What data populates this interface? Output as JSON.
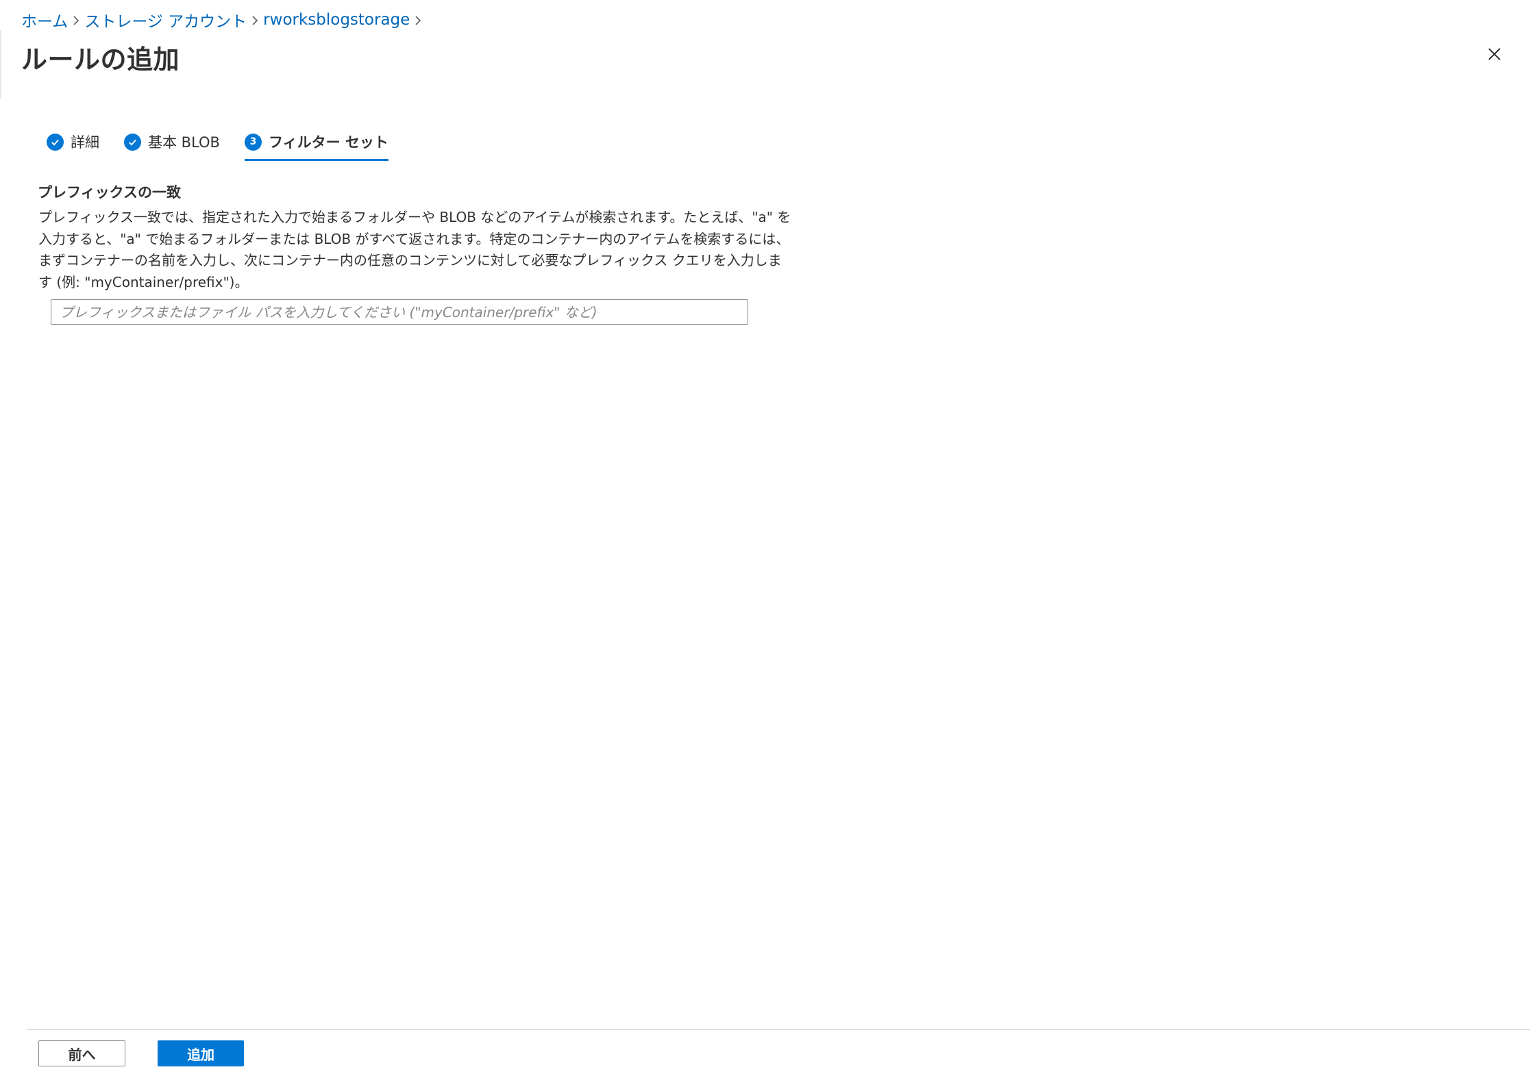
{
  "breadcrumb": {
    "items": [
      "ホーム",
      "ストレージ アカウント",
      "rworksblogstorage"
    ]
  },
  "title": "ルールの追加",
  "tabs": [
    {
      "label": "詳細",
      "state": "completed",
      "icon": "check-circle-icon"
    },
    {
      "label": "基本 BLOB",
      "state": "completed",
      "icon": "check-circle-icon"
    },
    {
      "label": "フィルター セット",
      "state": "active",
      "number": "3"
    }
  ],
  "section": {
    "title": "プレフィックスの一致",
    "description": "プレフィックス一致では、指定された入力で始まるフォルダーや BLOB などのアイテムが検索されます。たとえば、\"a\" を入力すると、\"a\" で始まるフォルダーまたは BLOB がすべて返されます。特定のコンテナー内のアイテムを検索するには、まずコンテナーの名前を入力し、次にコンテナー内の任意のコンテンツに対して必要なプレフィックス クエリを入力します (例: \"myContainer/prefix\")。",
    "input": {
      "value": "",
      "placeholder": "プレフィックスまたはファイル パスを入力してください (\"myContainer/prefix\" など)"
    }
  },
  "footer": {
    "prev_label": "前へ",
    "add_label": "追加"
  },
  "colors": {
    "accent": "#0078d4",
    "link": "#0066b8",
    "text": "#323130"
  }
}
